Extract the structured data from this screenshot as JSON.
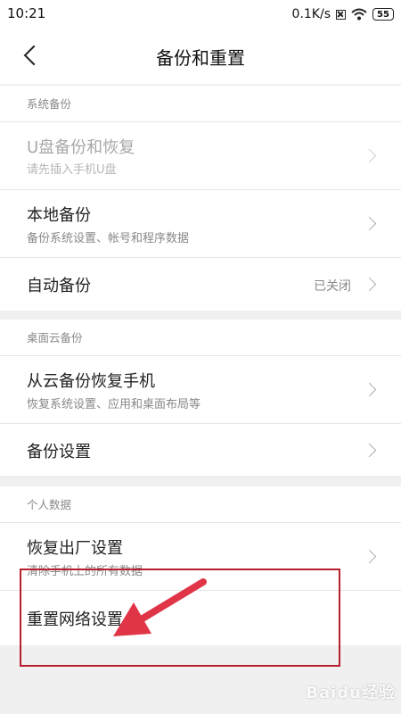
{
  "status_bar": {
    "time": "10:21",
    "network_speed": "0.1K/s",
    "battery_level": "55",
    "icons": [
      "sim-off-icon",
      "wifi-icon",
      "battery-icon"
    ]
  },
  "header": {
    "title": "备份和重置",
    "back_icon": "chevron-left-icon"
  },
  "sections": {
    "system_backup": {
      "header": "系统备份",
      "items": [
        {
          "title": "U盘备份和恢复",
          "subtitle": "请先插入手机U盘",
          "state": "disabled"
        },
        {
          "title": "本地备份",
          "subtitle": "备份系统设置、帐号和程序数据"
        },
        {
          "title": "自动备份",
          "value": "已关闭"
        }
      ]
    },
    "cloud_backup": {
      "header": "桌面云备份",
      "items": [
        {
          "title": "从云备份恢复手机",
          "subtitle": "恢复系统设置、应用和桌面布局等"
        },
        {
          "title": "备份设置"
        }
      ]
    },
    "personal_data": {
      "header": "个人数据",
      "items": [
        {
          "title": "恢复出厂设置",
          "subtitle": "清除手机上的所有数据"
        },
        {
          "title": "重置网络设置"
        }
      ]
    }
  },
  "annotation": {
    "box_color": "#b4202d",
    "arrow_color": "#e03447"
  },
  "watermark": "Baidu经验",
  "colors": {
    "background": "#f0f0f0",
    "card": "#ffffff",
    "primary_text": "#222222",
    "secondary_text": "#888888"
  }
}
